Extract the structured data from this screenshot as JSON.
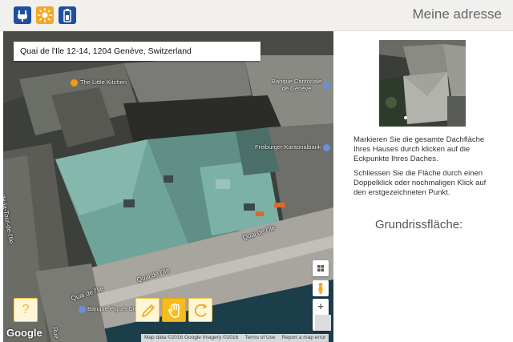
{
  "header": {
    "title": "Meine adresse",
    "icons": [
      "plug-icon",
      "sun-icon",
      "battery-icon"
    ],
    "accent_blue": "#1f4f9e",
    "accent_orange": "#f5a623"
  },
  "map": {
    "address": "Quai de l'Ile 12-14, 1204 Genève, Switzerland",
    "pois": {
      "kitchen": "The Little Kitchen",
      "bank1_line1": "Banque Cantonale",
      "bank1_line2": "de Genève",
      "bank2": "Freiburger Kantonalbank",
      "bank3": "Banque Piguet Cie"
    },
    "streets": {
      "quai1": "Quai de l'Ile",
      "quai2": "Quai de l'Ile",
      "quai3": "Quai de l'Ile",
      "tour": "de-la-Tour-de-l'Ile",
      "rue": "Rue"
    },
    "controls": {
      "zoom_in": "+",
      "zoom_out": "−",
      "help": "?"
    },
    "google": "Google",
    "attribution": {
      "data": "Map data ©2016 Google Imagery ©2016",
      "terms": "Terms of Use",
      "report": "Report a map error"
    }
  },
  "panel": {
    "instruction1": "Markieren Sie die gesamte Dachfläche Ihres Hauses durch klicken auf die Eckpunkte Ihres Daches.",
    "instruction2": "Schliessen Sie die Fläche durch einen Doppelklick oder nochmaligen Klick auf den erstgezeichneten Punkt.",
    "grundriss_label": "Grundrissfläche:"
  }
}
